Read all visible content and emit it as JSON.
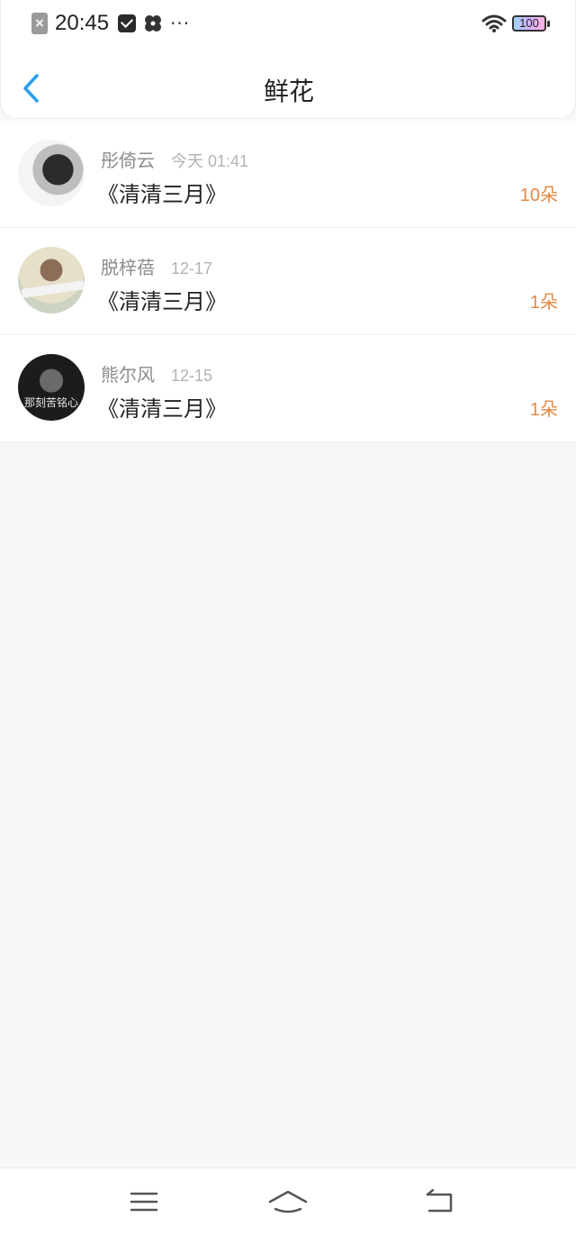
{
  "status_bar": {
    "time": "20:45",
    "more": "···",
    "battery": "100",
    "icons": [
      "close-notification-icon",
      "mail-icon",
      "pinwheel-icon",
      "more-icon",
      "wifi-icon",
      "battery-icon"
    ]
  },
  "header": {
    "title": "鲜花",
    "back_icon": "chevron-left-icon",
    "accent_color": "#2a9ff0"
  },
  "list": [
    {
      "user": "彤倚云",
      "time": "今天 01:41",
      "book": "《清清三月》",
      "count": "10朵"
    },
    {
      "user": "脱梓蓓",
      "time": "12-17",
      "book": "《清清三月》",
      "count": "1朵"
    },
    {
      "user": "熊尔风",
      "time": "12-15",
      "book": "《清清三月》",
      "count": "1朵",
      "avatar_text": "那刻苦铭心"
    }
  ],
  "colors": {
    "count": "#e48845",
    "background": "#f8f6f7"
  },
  "nav": {
    "icons": [
      "menu-icon",
      "home-icon",
      "back-icon"
    ]
  }
}
